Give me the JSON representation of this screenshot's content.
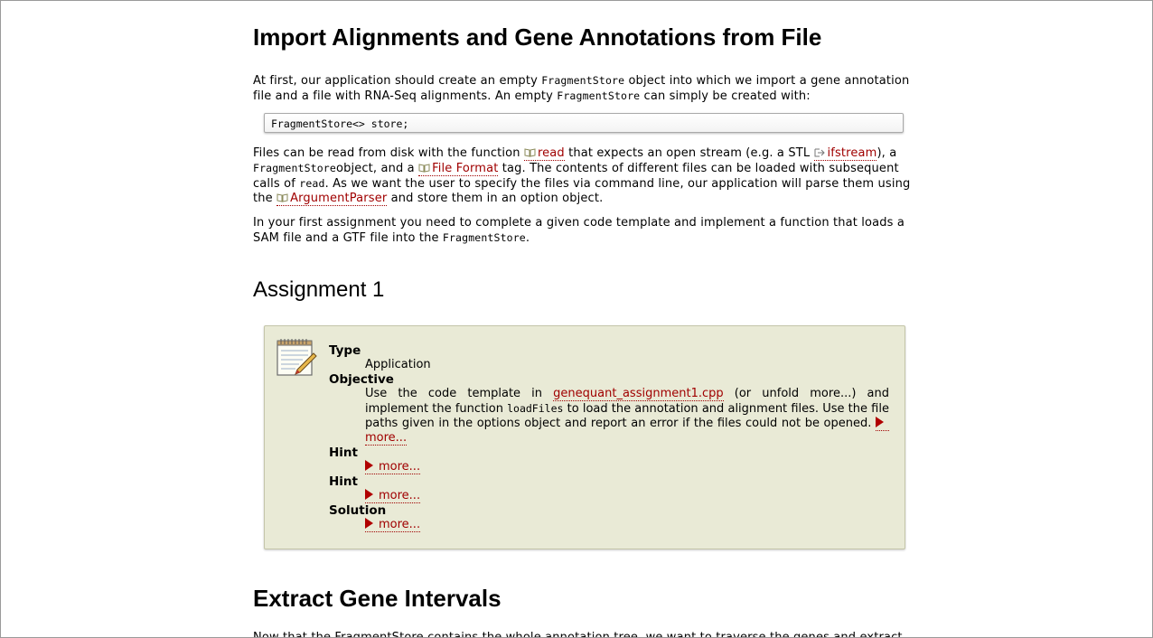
{
  "section1": {
    "title": "Import Alignments and Gene Annotations from File",
    "para1": {
      "t1": "At first, our application should create an empty ",
      "c1": "FragmentStore",
      "t2": " object into which we import a gene annotation file and a file with RNA-Seq alignments. An empty ",
      "c2": "FragmentStore",
      "t3": " can simply be created with:"
    },
    "code": "FragmentStore<> store;",
    "para2": {
      "t1": "Files can be read from disk with the function ",
      "link_read": "read",
      "t2": " that expects an open stream (e.g. a STL ",
      "link_ifstream": "ifstream",
      "t3": "), a ",
      "c1": "FragmentStore",
      "t4": "object, and a ",
      "link_fileformat": "File Format",
      "t5": " tag. The contents of different files can be loaded with subsequent calls of ",
      "c2": "read",
      "t6": ". As we want the user to specify the files via command line, our application will parse them using the ",
      "link_argparser": "ArgumentParser",
      "t7": " and store them in an option object."
    },
    "para3": {
      "t1": "In your first assignment you need to complete a given code template and implement a function that loads a SAM file and a GTF file into the ",
      "c1": "FragmentStore",
      "t2": "."
    }
  },
  "assignment": {
    "heading": "Assignment 1",
    "type_label": "Type",
    "type_value": "Application",
    "objective_label": "Objective",
    "objective": {
      "t1": "Use the code template in ",
      "link": "genequant_assignment1.cpp",
      "t2": " (or unfold more...) and implement the function ",
      "c1": "loadFiles",
      "t3": " to load the annotation and alignment files. Use the file paths given in the options object and report an error if the files could not be opened."
    },
    "more_label": "more...",
    "hint1_label": "Hint",
    "hint2_label": "Hint",
    "solution_label": "Solution"
  },
  "section2": {
    "title": "Extract Gene Intervals",
    "partial": "Now that the FragmentStore contains the whole annotation tree, we want to traverse the genes and extract"
  },
  "colors": {
    "link": "#a00000",
    "assignment_bg": "#e9ead6"
  }
}
